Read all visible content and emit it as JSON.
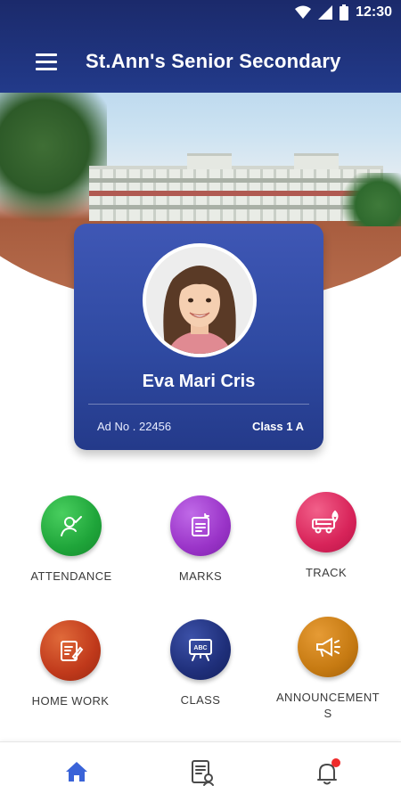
{
  "status_bar": {
    "time": "12:30",
    "icons": [
      "wifi-icon",
      "signal-icon",
      "battery-icon"
    ]
  },
  "header": {
    "title": "St.Ann's Senior Secondary",
    "menu_icon": "hamburger-menu-icon"
  },
  "profile": {
    "name": "Eva Mari Cris",
    "admission_no": "Ad No . 22456",
    "class": "Class 1 A"
  },
  "menu": [
    {
      "label": "ATTENDANCE",
      "icon": "attendance-icon",
      "color": "#1fa53a"
    },
    {
      "label": "MARKS",
      "icon": "marks-icon",
      "color": "#9a34c8"
    },
    {
      "label": "TRACK",
      "icon": "bus-track-icon",
      "color": "#d8245a"
    },
    {
      "label": "HOME WORK",
      "icon": "homework-icon",
      "color": "#c0391b"
    },
    {
      "label": "CLASS",
      "icon": "class-board-icon",
      "color": "#1f2f7a"
    },
    {
      "label": "ANNOUNCEMENT\nS",
      "icon": "megaphone-icon",
      "color": "#c67a12"
    }
  ],
  "bottom_nav": [
    {
      "icon": "home-icon",
      "active": true,
      "color": "#3a63d8"
    },
    {
      "icon": "report-icon",
      "active": false
    },
    {
      "icon": "bell-icon",
      "active": false,
      "badge": true
    }
  ],
  "colors": {
    "header": "#1f3079",
    "card": "#2f4aa2",
    "nav_active": "#3a63d8"
  }
}
